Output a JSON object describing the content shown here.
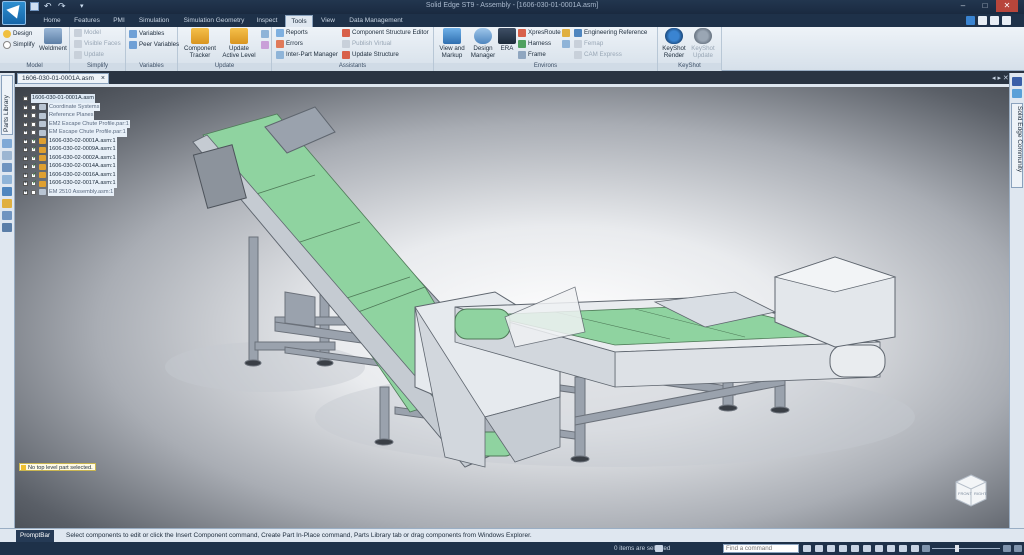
{
  "titlebar": {
    "title": "Solid Edge ST9 - Assembly - [1606-030-01-0001A.asm]",
    "min": "–",
    "max": "□",
    "close": "✕"
  },
  "tabs": [
    "Home",
    "Features",
    "PMI",
    "Simulation",
    "Simulation Geometry",
    "Inspect",
    "Tools",
    "View",
    "Data Management"
  ],
  "active_tab": "Tools",
  "ribbon": {
    "model": {
      "label": "Model",
      "design": "Design",
      "simplify": "Simplify",
      "weldment": "Weldment"
    },
    "simplify": {
      "label": "Simplify",
      "model": "Model",
      "visible_faces": "Visible Faces",
      "update": "Update"
    },
    "variables": {
      "label": "Variables",
      "variables": "Variables",
      "peer_variables": "Peer Variables"
    },
    "update": {
      "label": "Update",
      "component_tracker": "Component Tracker",
      "update_active_level": "Update Active Level"
    },
    "assistants": {
      "label": "Assistants",
      "reports": "Reports",
      "errors": "Errors",
      "inter_part_manager": "Inter-Part Manager",
      "component_structure_editor": "Component Structure Editor",
      "publish_virtual": "Publish Virtual",
      "update_structure": "Update Structure"
    },
    "environs": {
      "label": "Environs",
      "view_and_markup": "View and Markup",
      "design_manager": "Design Manager",
      "era": "ERA",
      "xpresroute": "XpresRoute",
      "harness": "Harness",
      "frame": "Frame",
      "engineering_reference": "Engineering Reference",
      "femap": "Femap",
      "cam_express": "CAM Express"
    },
    "keyshot": {
      "label": "KeyShot",
      "render": "KeyShot Render",
      "update": "KeyShot Update"
    }
  },
  "document": {
    "tab": "1606-030-01-0001A.asm"
  },
  "left_panel": {
    "parts_library": "Parts Library"
  },
  "right_panel": {
    "community": "Solid Edge Community"
  },
  "tree": {
    "root": "1606-030-01-0001A.asm",
    "items": [
      {
        "label": "Coordinate Systems",
        "checked": false,
        "muted": true
      },
      {
        "label": "Reference Planes",
        "checked": false,
        "muted": true
      },
      {
        "label": "EM2 Escape Chute Profile.par:1",
        "checked": false,
        "muted": true
      },
      {
        "label": "EM Escape Chute Profile.par:1",
        "checked": false,
        "muted": true
      },
      {
        "label": "1606-030-02-0001A.asm:1",
        "checked": true,
        "muted": false
      },
      {
        "label": "1606-030-02-0009A.asm:1",
        "checked": true,
        "muted": false
      },
      {
        "label": "1606-030-02-0002A.asm:1",
        "checked": true,
        "muted": false
      },
      {
        "label": "1606-030-02-0014A.asm:1",
        "checked": true,
        "muted": false
      },
      {
        "label": "1606-030-02-0016A.asm:1",
        "checked": true,
        "muted": false
      },
      {
        "label": "1606-030-02-0017A.asm:1",
        "checked": true,
        "muted": false
      },
      {
        "label": "EM 2510 Assembly.asm:1",
        "checked": false,
        "muted": true
      }
    ]
  },
  "viewport": {
    "status_message": "No top level part selected.",
    "viewcube_front": "FRONT",
    "viewcube_right": "RIGHT"
  },
  "promptbar": {
    "label": "PromptBar",
    "text": "Select components to edit or click the Insert Component command, Create Part In-Place command, Parts Library tab or drag components from Windows Explorer."
  },
  "statusbar": {
    "selected": "0 items are selected",
    "find_placeholder": "Find a command"
  },
  "colors": {
    "belt_green": "#8fd3a0",
    "frame_gray": "#b8bec8",
    "accent_blue": "#1e3149"
  }
}
